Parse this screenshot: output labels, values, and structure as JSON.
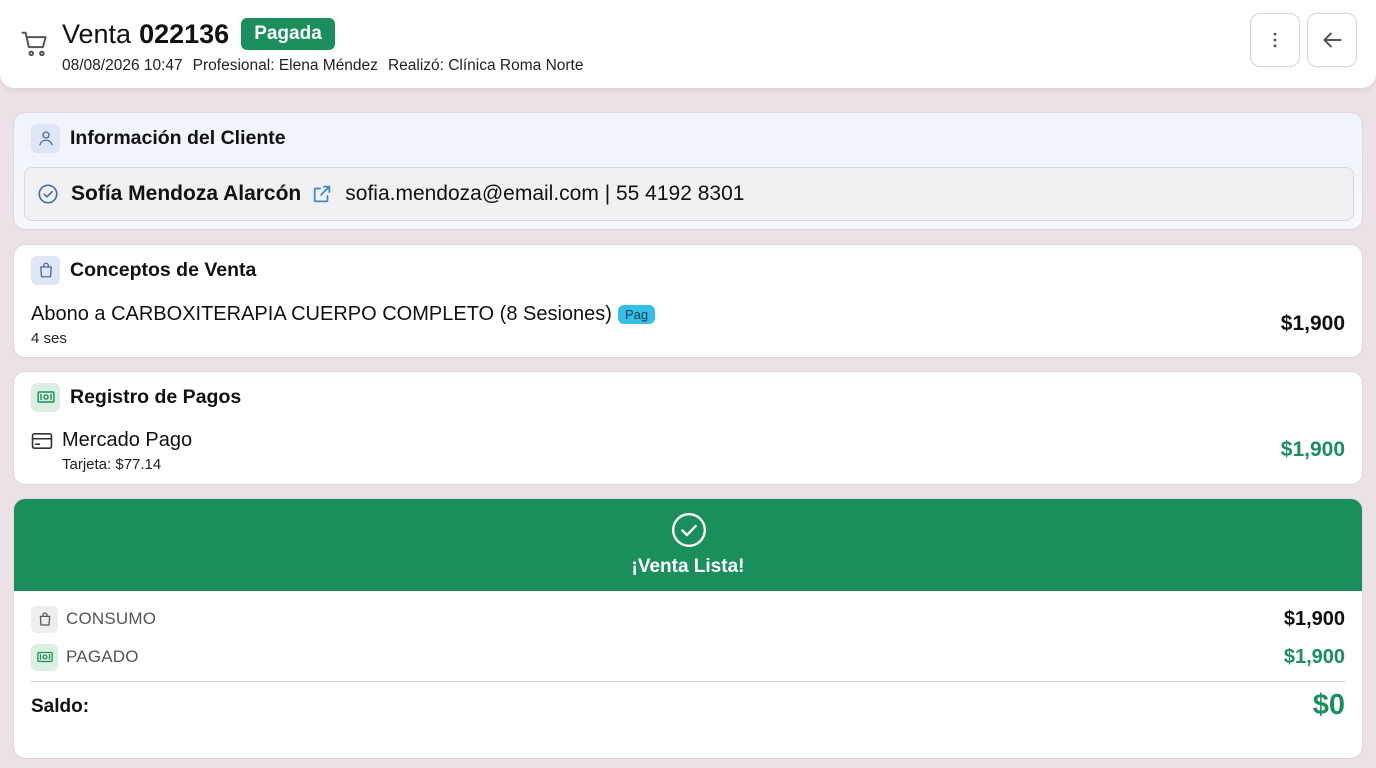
{
  "header": {
    "title_word": "Venta",
    "sale_number": "022136",
    "status": "Pagada",
    "date": "08/08/2026 10:47",
    "professional": "Profesional: Elena Méndez",
    "made_by": "Realizó: Clínica Roma Norte"
  },
  "client_section": {
    "title": "Información del Cliente",
    "name": "Sofía Mendoza Alarcón",
    "contact": "sofia.mendoza@email.com | 55 4192 8301"
  },
  "concepts_section": {
    "title": "Conceptos de Venta",
    "items": [
      {
        "name": "Abono a CARBOXITERAPIA CUERPO COMPLETO (8 Sesiones)",
        "badge": "Pag",
        "sub": "4 ses",
        "amount": "$1,900"
      }
    ]
  },
  "payments_section": {
    "title": "Registro de Pagos",
    "items": [
      {
        "method": "Mercado Pago",
        "sub": "Tarjeta: $77.14",
        "amount": "$1,900"
      }
    ]
  },
  "summary": {
    "banner_text": "¡Venta Lista!",
    "consumo_label": "CONSUMO",
    "consumo_value": "$1,900",
    "pagado_label": "PAGADO",
    "pagado_value": "$1,900",
    "saldo_label": "Saldo:",
    "saldo_value": "$0"
  },
  "icons": {
    "cart": "shopping-cart-icon",
    "more": "more-vertical-icon",
    "back": "arrow-left-icon",
    "user": "user-icon",
    "verified": "check-circle-icon",
    "external": "external-link-icon",
    "bag": "shopping-bag-icon",
    "cash": "banknote-icon",
    "card": "credit-card-icon"
  },
  "colors": {
    "accent_green": "#1a8f5c",
    "accent_blue": "#4d68a8",
    "badge_cyan": "#35bfe6",
    "background": "#ece1e6"
  }
}
